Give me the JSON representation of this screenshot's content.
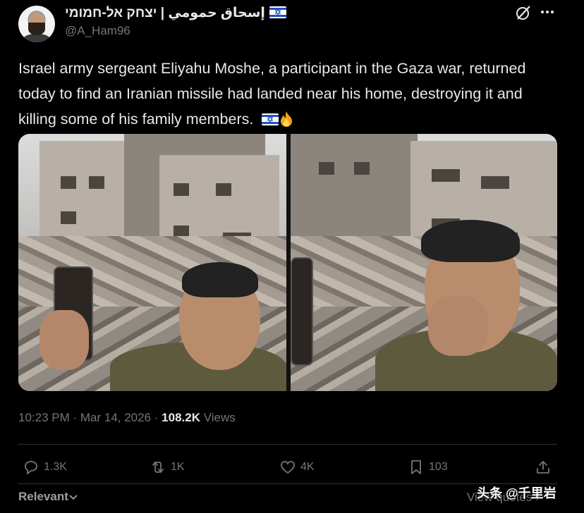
{
  "author": {
    "display_name": "إسحاق حمومي | יצחק אל-חמומי",
    "handle": "@A_Ham96",
    "flag_icon": "israel-flag-icon"
  },
  "tweet": {
    "text": "Israel army sergeant Eliyahu Moshe, a participant in the Gaza war, returned today to find an Iranian missile had landed near his home, destroying it and killing some of his family members.",
    "emoji_icons": [
      "israel-flag-icon",
      "fire-icon"
    ]
  },
  "meta": {
    "time": "10:23 PM",
    "date": "Mar 14, 2026",
    "views_count": "108.2K",
    "views_label": "Views"
  },
  "actions": {
    "replies": "1.3K",
    "reposts": "1K",
    "likes": "4K",
    "bookmarks": "103"
  },
  "footer": {
    "sort_label": "Relevant",
    "view_quotes": "View quotes",
    "watermark": "头条 @千里岩"
  },
  "colors": {
    "background": "#000000",
    "text": "#e7e9ea",
    "muted": "#71767b",
    "divider": "#2f3336"
  }
}
